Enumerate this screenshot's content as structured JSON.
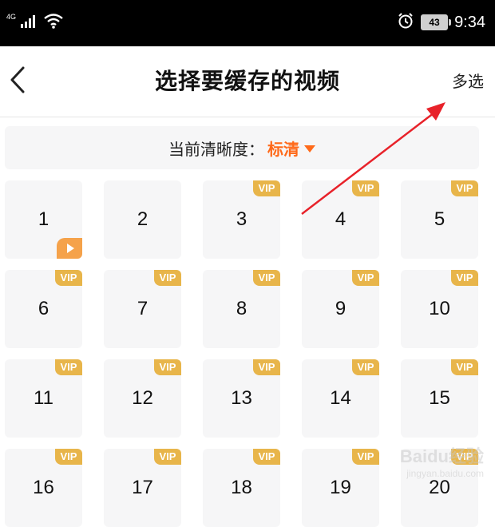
{
  "status_bar": {
    "network_type": "4G",
    "battery_level": "43",
    "time": "9:34",
    "icons": [
      "signal-icon",
      "wifi-icon",
      "alarm-icon",
      "battery-icon"
    ]
  },
  "header": {
    "back_icon": "chevron-left-icon",
    "title": "选择要缓存的视频",
    "multi_select_label": "多选"
  },
  "quality": {
    "label": "当前清晰度：",
    "value": "标清",
    "accent_color": "#ff6a1a"
  },
  "episodes": [
    {
      "num": "1",
      "vip": false,
      "playing": true
    },
    {
      "num": "2",
      "vip": false
    },
    {
      "num": "3",
      "vip": true
    },
    {
      "num": "4",
      "vip": true
    },
    {
      "num": "5",
      "vip": true
    },
    {
      "num": "6",
      "vip": true
    },
    {
      "num": "7",
      "vip": true
    },
    {
      "num": "8",
      "vip": true
    },
    {
      "num": "9",
      "vip": true
    },
    {
      "num": "10",
      "vip": true
    },
    {
      "num": "11",
      "vip": true
    },
    {
      "num": "12",
      "vip": true
    },
    {
      "num": "13",
      "vip": true
    },
    {
      "num": "14",
      "vip": true
    },
    {
      "num": "15",
      "vip": true
    },
    {
      "num": "16",
      "vip": true
    },
    {
      "num": "17",
      "vip": true
    },
    {
      "num": "18",
      "vip": true
    },
    {
      "num": "19",
      "vip": true
    },
    {
      "num": "20",
      "vip": true
    }
  ],
  "vip_label": "VIP",
  "vip_color": "#e8b54a",
  "annotation_color": "#e8222a",
  "watermark": {
    "logo": "Baidu经验",
    "url": "jingyan.baidu.com"
  }
}
